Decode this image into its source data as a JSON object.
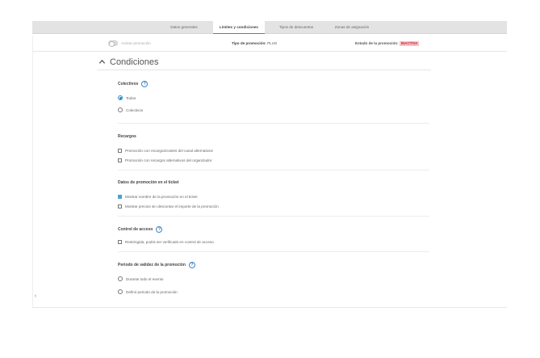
{
  "tabs": [
    {
      "label": "Datos generales"
    },
    {
      "label": "Límites y condiciones"
    },
    {
      "label": "Tipos de descuentos"
    },
    {
      "label": "Zonas de asignación"
    }
  ],
  "status": {
    "activate_label": "Activar promoción",
    "type_prefix": "Tipo de promoción:",
    "type_value": "PLUS",
    "state_prefix": "Estado de la promoción:",
    "state_value": "INACTIVA"
  },
  "section": {
    "title": "Condiciones"
  },
  "groups": {
    "colectivos": {
      "title": "Colectivos",
      "options": [
        {
          "label": "Todos",
          "selected": true
        },
        {
          "label": "Colectivos",
          "selected": false
        }
      ]
    },
    "recargos": {
      "title": "Recargos",
      "options": [
        {
          "label": "Promoción con recargos/costes del canal alternativos",
          "checked": false
        },
        {
          "label": "Promoción con recargos alternativos del organizador",
          "checked": false
        }
      ]
    },
    "ticket": {
      "title": "Datos de promoción en el ticket",
      "options": [
        {
          "label": "Mostrar nombre de la promoción en el ticket",
          "checked": true
        },
        {
          "label": "Mostrar precios sin descontar el importe de la promoción",
          "checked": false
        }
      ]
    },
    "acceso": {
      "title": "Control de acceso",
      "options": [
        {
          "label": "Restringida, podrá ser verificado en control de acceso",
          "checked": false
        }
      ]
    },
    "validez": {
      "title": "Periodo de validez de la promoción",
      "options": [
        {
          "label": "Durante todo el evento",
          "selected": false
        },
        {
          "label": "Definir periodo de la promoción",
          "selected": false
        }
      ]
    }
  },
  "icons": {
    "help": "question-circle-icon",
    "chevron": "chevron-up-icon",
    "collapse": "chevron-left-icon"
  },
  "colors": {
    "accent": "#2a8fc2",
    "inactive_badge_bg": "#f3c4c9",
    "inactive_badge_text": "#d0283a"
  }
}
